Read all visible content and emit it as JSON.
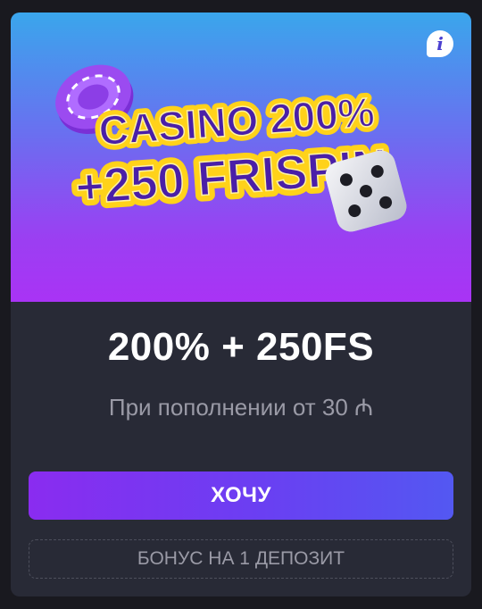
{
  "banner": {
    "headline_line1": "CASINO 200%",
    "headline_line2": "+250 FRISPIN",
    "chip_icon": "casino-chip-icon",
    "dice_icon": "dice-icon"
  },
  "info_button": {
    "icon": "info-icon",
    "glyph": "i"
  },
  "offer": {
    "title": "200% + 250FS",
    "subtitle": "При пополнении от 30 ₼"
  },
  "buttons": {
    "cta_label": "ХОЧУ",
    "secondary_label": "БОНУС НА 1 ДЕПОЗИТ"
  },
  "colors": {
    "card_bg": "#282a36",
    "page_bg": "#19191f",
    "accent_purple": "#8a2cf0",
    "accent_blue": "#5358f2",
    "headline_yellow": "#ffd21a",
    "headline_purple": "#4a1fa8"
  }
}
